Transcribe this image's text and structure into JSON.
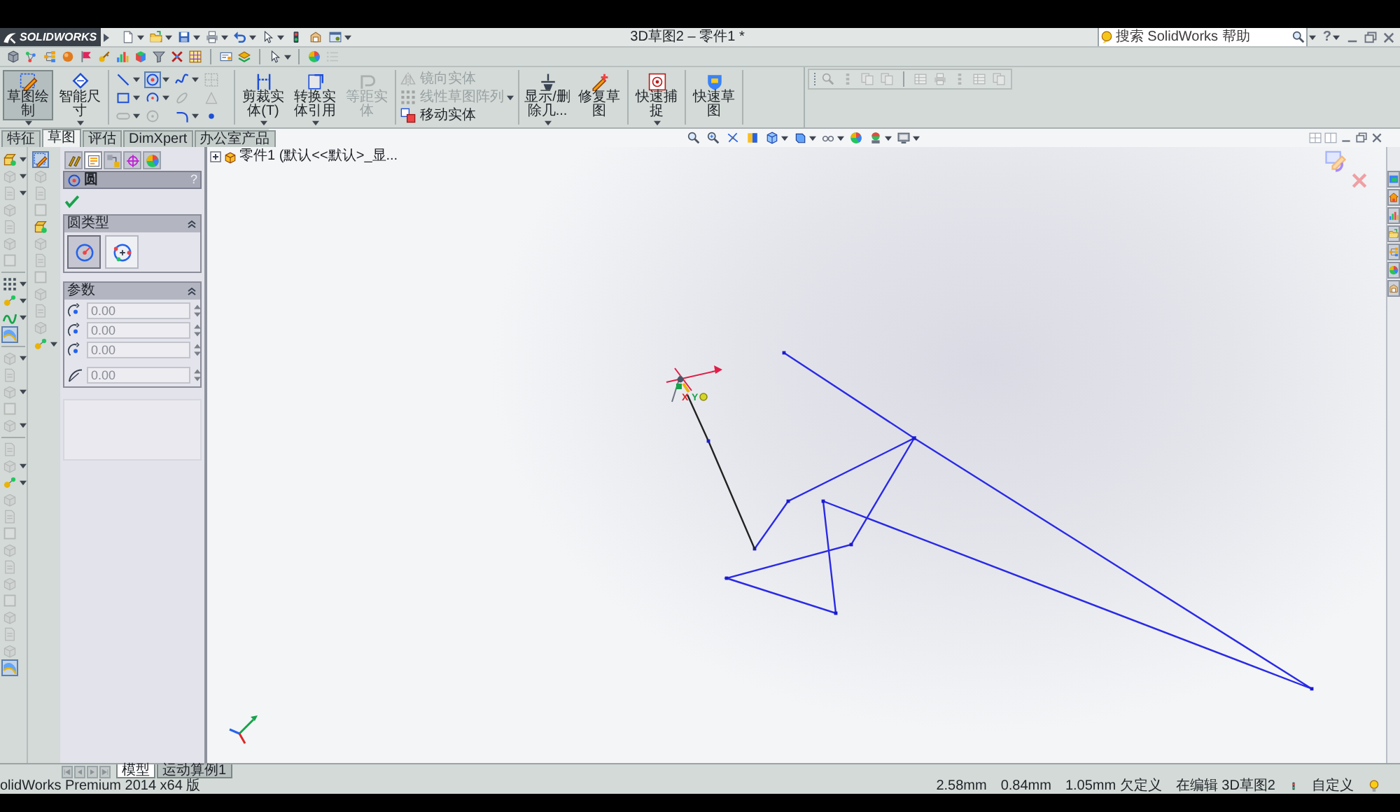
{
  "window": {
    "logo": "SOLIDWORKS",
    "title": "3D草图2 – 零件1 *",
    "search": {
      "placeholder": "搜索 SolidWorks 帮助"
    },
    "help": "?"
  },
  "quick_access": [
    {
      "kind": "new",
      "dropdown": true
    },
    {
      "kind": "open",
      "dropdown": true
    },
    {
      "kind": "save",
      "dropdown": true
    },
    {
      "kind": "print",
      "dropdown": true
    },
    {
      "kind": "undo",
      "dropdown": true
    },
    {
      "kind": "select",
      "dropdown": true
    },
    {
      "kind": "rebuild",
      "dropdown": false
    },
    {
      "kind": "properties",
      "dropdown": false
    },
    {
      "kind": "options",
      "dropdown": true
    }
  ],
  "toolbar": [
    {
      "kind": "cube",
      "disabled": false,
      "dropdown": false
    },
    {
      "kind": "nodes",
      "disabled": false,
      "dropdown": false
    },
    {
      "kind": "tree",
      "disabled": false,
      "dropdown": false
    },
    {
      "kind": "ball",
      "disabled": false,
      "dropdown": false
    },
    {
      "kind": "flag",
      "disabled": false,
      "dropdown": false
    },
    {
      "kind": "key",
      "disabled": false,
      "dropdown": false
    },
    {
      "kind": "chart",
      "disabled": false,
      "dropdown": false
    },
    {
      "kind": "rainbow",
      "disabled": false,
      "dropdown": false
    },
    {
      "kind": "funnel",
      "disabled": false,
      "dropdown": false
    },
    {
      "kind": "wrench",
      "disabled": false,
      "dropdown": false
    },
    {
      "kind": "grid",
      "disabled": false,
      "dropdown": false
    },
    {
      "kind": "separator"
    },
    {
      "kind": "sheet",
      "disabled": false,
      "dropdown": false
    },
    {
      "kind": "palette",
      "disabled": false,
      "dropdown": false
    },
    {
      "kind": "separator"
    },
    {
      "kind": "select",
      "disabled": false,
      "dropdown": true
    },
    {
      "kind": "separator"
    },
    {
      "kind": "appearance",
      "disabled": false,
      "dropdown": false
    },
    {
      "kind": "list",
      "disabled": true,
      "dropdown": false
    }
  ],
  "command_manager": [
    {
      "kind": "large",
      "items": [
        {
          "kind": "sketch",
          "label": "草图绘制",
          "selected": true,
          "disabled": false,
          "dropdown": true
        },
        {
          "kind": "dimension",
          "label": "智能尺寸",
          "selected": false,
          "disabled": false,
          "dropdown": true
        }
      ]
    },
    {
      "kind": "grid",
      "items": [
        {
          "kind": "line",
          "selected": false,
          "disabled": false,
          "dropdown": true
        },
        {
          "kind": "circle",
          "selected": true,
          "disabled": false,
          "dropdown": true
        },
        {
          "kind": "spline",
          "selected": false,
          "disabled": false,
          "dropdown": true
        },
        {
          "kind": "textgrid",
          "selected": false,
          "disabled": true,
          "dropdown": false
        },
        {
          "kind": "rectangle",
          "selected": false,
          "disabled": false,
          "dropdown": true
        },
        {
          "kind": "arc",
          "selected": false,
          "disabled": false,
          "dropdown": true
        },
        {
          "kind": "ellipse",
          "selected": false,
          "disabled": true,
          "dropdown": false
        },
        {
          "kind": "plane",
          "selected": false,
          "disabled": true,
          "dropdown": false
        },
        {
          "kind": "slot",
          "selected": false,
          "disabled": true,
          "dropdown": true
        },
        {
          "kind": "polygon",
          "selected": false,
          "disabled": true,
          "dropdown": false
        },
        {
          "kind": "fillet",
          "selected": false,
          "disabled": false,
          "dropdown": true
        },
        {
          "kind": "point",
          "selected": false,
          "disabled": false,
          "dropdown": false
        }
      ]
    },
    {
      "kind": "large",
      "items": [
        {
          "kind": "trim",
          "label": "剪裁实体(T)",
          "selected": false,
          "disabled": false,
          "dropdown": true
        },
        {
          "kind": "convert",
          "label": "转换实体引用",
          "selected": false,
          "disabled": false,
          "dropdown": true
        },
        {
          "kind": "offset",
          "label": "等距实体",
          "selected": false,
          "disabled": true,
          "dropdown": false
        }
      ]
    },
    {
      "kind": "list",
      "dropdown": true,
      "items": [
        {
          "kind": "mirror",
          "label": "镜向实体",
          "disabled": true
        },
        {
          "kind": "pattern",
          "label": "线性草图阵列",
          "disabled": true
        },
        {
          "kind": "move",
          "label": "移动实体",
          "disabled": false
        }
      ]
    },
    {
      "kind": "large",
      "items": [
        {
          "kind": "relations",
          "label": "显示/删除几...",
          "selected": false,
          "disabled": false,
          "dropdown": true
        },
        {
          "kind": "repair",
          "label": "修复草图",
          "selected": false,
          "disabled": false,
          "dropdown": false
        }
      ]
    },
    {
      "kind": "large",
      "items": [
        {
          "kind": "snap",
          "label": "快速捕捉",
          "selected": false,
          "disabled": false,
          "dropdown": true
        }
      ]
    },
    {
      "kind": "large",
      "items": [
        {
          "kind": "rapid",
          "label": "快速草图",
          "selected": false,
          "disabled": false,
          "dropdown": false
        }
      ]
    }
  ],
  "right_toolbar": [
    {
      "kind": "zoomfit",
      "disabled": true
    },
    {
      "kind": "dots",
      "disabled": true
    },
    {
      "kind": "pages",
      "disabled": true
    },
    {
      "kind": "pages",
      "disabled": true
    },
    {
      "kind": "separator"
    },
    {
      "kind": "table",
      "disabled": true
    },
    {
      "kind": "print",
      "disabled": true
    },
    {
      "kind": "dots",
      "disabled": true
    },
    {
      "kind": "table",
      "disabled": true
    },
    {
      "kind": "pages",
      "disabled": true
    }
  ],
  "tabs": [
    {
      "label": "特征",
      "selected": false
    },
    {
      "label": "草图",
      "selected": true
    },
    {
      "label": "评估",
      "selected": false
    },
    {
      "label": "DimXpert",
      "selected": false
    },
    {
      "label": "办公室产品",
      "selected": false
    }
  ],
  "view_toolbar": [
    {
      "kind": "zoomfit",
      "dropdown": false
    },
    {
      "kind": "zoomarea",
      "dropdown": false
    },
    {
      "kind": "previous",
      "dropdown": false
    },
    {
      "kind": "section",
      "dropdown": false
    },
    {
      "kind": "orient",
      "dropdown": true
    },
    {
      "kind": "display",
      "dropdown": true
    },
    {
      "kind": "hide",
      "dropdown": true
    },
    {
      "kind": "appearance",
      "dropdown": false
    },
    {
      "kind": "scene",
      "dropdown": true
    },
    {
      "kind": "viewset",
      "dropdown": true
    }
  ],
  "viewport_controls": [
    {
      "kind": "splitfour"
    },
    {
      "kind": "splittwo"
    },
    {
      "kind": "minimize"
    },
    {
      "kind": "restore"
    },
    {
      "kind": "close"
    }
  ],
  "left_toolbar": [
    {
      "kind": "feature",
      "disabled": false,
      "selected": false,
      "dropdown": true
    },
    {
      "kind": "block",
      "disabled": true,
      "selected": false,
      "dropdown": true
    },
    {
      "kind": "page",
      "disabled": true,
      "selected": false,
      "dropdown": true
    },
    {
      "kind": "block",
      "disabled": true,
      "selected": false,
      "dropdown": false
    },
    {
      "kind": "page",
      "disabled": true,
      "selected": false,
      "dropdown": false
    },
    {
      "kind": "block",
      "disabled": true,
      "selected": false,
      "dropdown": false
    },
    {
      "kind": "frame",
      "disabled": true,
      "selected": false,
      "dropdown": false
    },
    {
      "kind": "separator"
    },
    {
      "kind": "pattern",
      "disabled": false,
      "selected": false,
      "dropdown": true
    },
    {
      "kind": "yellowpoint",
      "disabled": false,
      "selected": false,
      "dropdown": true
    },
    {
      "kind": "curve",
      "disabled": false,
      "selected": false,
      "dropdown": true
    },
    {
      "kind": "surface",
      "disabled": false,
      "selected": true,
      "dropdown": false
    },
    {
      "kind": "separator"
    },
    {
      "kind": "block",
      "disabled": true,
      "selected": false,
      "dropdown": true
    },
    {
      "kind": "page",
      "disabled": true,
      "selected": false,
      "dropdown": false
    },
    {
      "kind": "block",
      "disabled": true,
      "selected": false,
      "dropdown": true
    },
    {
      "kind": "frame",
      "disabled": true,
      "selected": false,
      "dropdown": false
    },
    {
      "kind": "block",
      "disabled": true,
      "selected": false,
      "dropdown": true
    },
    {
      "kind": "separator"
    },
    {
      "kind": "page",
      "disabled": true,
      "selected": false,
      "dropdown": false
    },
    {
      "kind": "block",
      "disabled": true,
      "selected": false,
      "dropdown": true
    },
    {
      "kind": "yellowpoint",
      "disabled": false,
      "selected": false,
      "dropdown": true
    },
    {
      "kind": "block",
      "disabled": true,
      "selected": false,
      "dropdown": false
    },
    {
      "kind": "page",
      "disabled": true,
      "selected": false,
      "dropdown": false
    },
    {
      "kind": "frame",
      "disabled": true,
      "selected": false,
      "dropdown": false
    },
    {
      "kind": "block",
      "disabled": true,
      "selected": false,
      "dropdown": false
    },
    {
      "kind": "page",
      "disabled": true,
      "selected": false,
      "dropdown": false
    },
    {
      "kind": "block",
      "disabled": true,
      "selected": false,
      "dropdown": false
    },
    {
      "kind": "frame",
      "disabled": true,
      "selected": false,
      "dropdown": false
    },
    {
      "kind": "block",
      "disabled": true,
      "selected": false,
      "dropdown": false
    },
    {
      "kind": "page",
      "disabled": true,
      "selected": false,
      "dropdown": false
    },
    {
      "kind": "block",
      "disabled": true,
      "selected": false,
      "dropdown": false
    },
    {
      "kind": "surface",
      "disabled": false,
      "selected": true,
      "dropdown": false
    }
  ],
  "sketch_toolbar": [
    {
      "kind": "sketch",
      "disabled": false,
      "selected": true,
      "dropdown": false
    },
    {
      "kind": "block",
      "disabled": true,
      "selected": false,
      "dropdown": false
    },
    {
      "kind": "page",
      "disabled": true,
      "selected": false,
      "dropdown": false
    },
    {
      "kind": "frame",
      "disabled": true,
      "selected": false,
      "dropdown": false
    },
    {
      "kind": "feature",
      "disabled": false,
      "selected": false,
      "dropdown": false
    },
    {
      "kind": "block",
      "disabled": true,
      "selected": false,
      "dropdown": false
    },
    {
      "kind": "page",
      "disabled": true,
      "selected": false,
      "dropdown": false
    },
    {
      "kind": "frame",
      "disabled": true,
      "selected": false,
      "dropdown": false
    },
    {
      "kind": "block",
      "disabled": true,
      "selected": false,
      "dropdown": false
    },
    {
      "kind": "page",
      "disabled": true,
      "selected": false,
      "dropdown": false
    },
    {
      "kind": "block",
      "disabled": true,
      "selected": false,
      "dropdown": false
    },
    {
      "kind": "yellowpoint",
      "disabled": false,
      "selected": false,
      "dropdown": true
    }
  ],
  "property_manager": {
    "tabs": [
      {
        "kind": "pencils",
        "selected": false
      },
      {
        "kind": "propsheet",
        "selected": true
      },
      {
        "kind": "config",
        "selected": false
      },
      {
        "kind": "crosshair",
        "selected": false
      },
      {
        "kind": "appearance",
        "selected": false
      }
    ],
    "title": "圆",
    "help": "?",
    "groups": [
      {
        "kind": "circle_type",
        "title": "圆类型",
        "expanded": true,
        "options": [
          {
            "kind": "center",
            "selected": true
          },
          {
            "kind": "perimeter",
            "selected": false
          }
        ]
      },
      {
        "kind": "parameters",
        "title": "参数",
        "expanded": true,
        "fields": [
          {
            "kind": "x",
            "value": "0.00"
          },
          {
            "kind": "y",
            "value": "0.00"
          },
          {
            "kind": "z",
            "value": "0.00"
          },
          {
            "kind": "radius",
            "value": "0.00"
          }
        ]
      }
    ]
  },
  "feature_tree": {
    "label": "零件1 (默认<<默认>_显...",
    "expanded": false
  },
  "origin_hints": [
    "X",
    "Y"
  ],
  "confirmation_corner": [
    {
      "kind": "exit_sketch"
    },
    {
      "kind": "cancel"
    }
  ],
  "task_pane": [
    {
      "kind": "resources"
    },
    {
      "kind": "home"
    },
    {
      "kind": "chart"
    },
    {
      "kind": "open"
    },
    {
      "kind": "tree"
    },
    {
      "kind": "appearance"
    },
    {
      "kind": "properties"
    }
  ],
  "bottom_tabs": [
    {
      "label": "模型",
      "selected": true
    },
    {
      "label": "运动算例1",
      "selected": false
    }
  ],
  "status_bar": {
    "product": "olidWorks Premium 2014 x64 版",
    "readouts": [
      "2.58mm",
      "0.84mm",
      "1.05mm 欠定义"
    ],
    "mode": "在编辑 3D草图2",
    "units": "自定义"
  }
}
